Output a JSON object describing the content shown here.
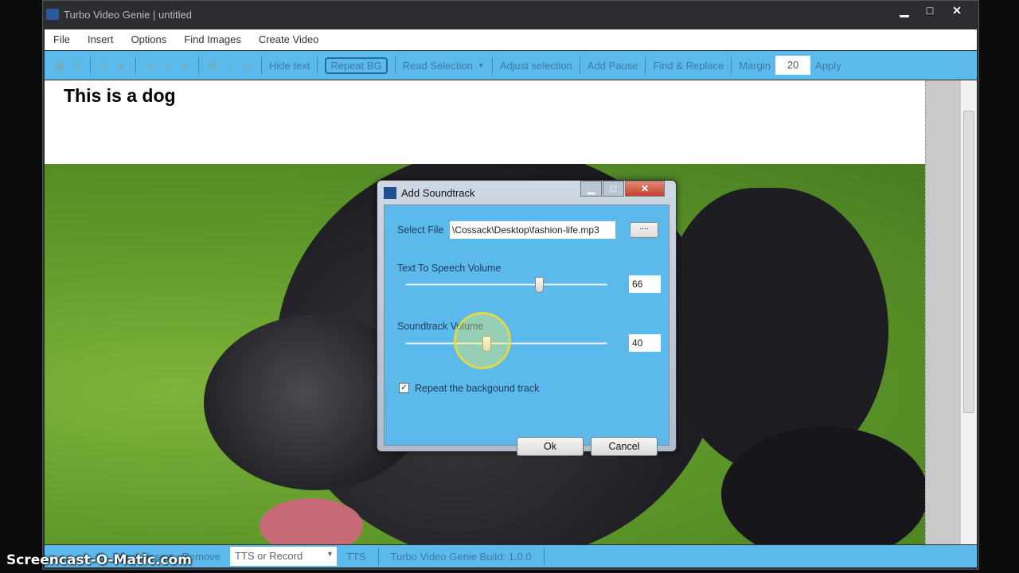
{
  "window": {
    "title": "Turbo Video Genie | untitled",
    "minimize": "▁",
    "maximize": "□",
    "close": "✕"
  },
  "menu": [
    "File",
    "Insert",
    "Options",
    "Find Images",
    "Create Video"
  ],
  "toolbar": {
    "hide_text": "Hide text",
    "repeat_bg": "Repeat BG",
    "read_selection": "Read Selection",
    "dropdown": "▼",
    "adjust_selection": "Adjust selection",
    "add_pause": "Add Pause",
    "find_replace": "Find & Replace",
    "margin_label": "Margin",
    "margin_value": "20",
    "apply": "Apply",
    "bold": "B",
    "italic": "I",
    "underline": "U",
    "font": "A"
  },
  "editor": {
    "heading": "This is a dog"
  },
  "bottombar": {
    "new": "New",
    "insert": "Insert",
    "remove": "Remove",
    "tts_select": "TTS or Record",
    "tts": "TTS",
    "build": "Turbo Video Genie Build: 1.0.0"
  },
  "watermark": "Screencast-O-Matic.com",
  "dialog": {
    "title": "Add Soundtrack",
    "select_file_label": "Select File",
    "file_path": "\\Cossack\\Desktop\\fashion-life.mp3",
    "browse": "....",
    "tts_volume_label": "Text To Speech Volume",
    "tts_volume": "66",
    "tts_volume_value": 66,
    "soundtrack_volume_label": "Soundtrack Volume",
    "soundtrack_volume": "40",
    "soundtrack_volume_value": 40,
    "repeat_label": "Repeat the backgound track",
    "repeat_checked": true,
    "ok": "Ok",
    "cancel": "Cancel"
  }
}
